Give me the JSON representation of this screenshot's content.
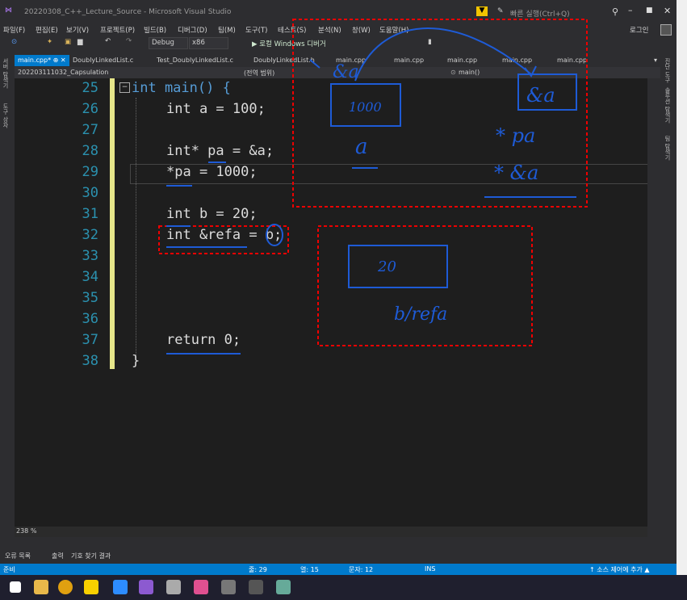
{
  "title": "20220308_C++_Lecture_Source - Microsoft Visual Studio",
  "search_placeholder": "빠른 실행(Ctrl+Q)",
  "login": "로그인",
  "menu": [
    "파일(F)",
    "편집(E)",
    "보기(V)",
    "프로젝트(P)",
    "빌드(B)",
    "디버그(D)",
    "팀(M)",
    "도구(T)",
    "테스트(S)",
    "분석(N)",
    "창(W)",
    "도움말(H)"
  ],
  "toolbar": {
    "config": "Debug",
    "platform": "x86",
    "run": "▶ 로컬 Windows 디버거"
  },
  "tabs": [
    "main.cpp*",
    "DoublyLinkedList.c",
    "Test_DoublyLinkedList.c",
    "DoublyLinkedList.h",
    "main.cpp",
    "main.cpp",
    "main.cpp",
    "main.cpp",
    "main.cpp"
  ],
  "nav": {
    "project": "202203111032_Capsulation",
    "scope": "(전역 범위)",
    "func": "main()"
  },
  "left_panel": [
    "서버 탐색기",
    "도구 상자"
  ],
  "right_panel": [
    "진단 도구",
    "솔루션 탐색기",
    "팀 탐색기"
  ],
  "lines": [
    {
      "n": "25",
      "text": "int main() {"
    },
    {
      "n": "26",
      "text": "int a = 100;"
    },
    {
      "n": "27",
      "text": ""
    },
    {
      "n": "28",
      "text": "int* pa = &a;"
    },
    {
      "n": "29",
      "text": "*pa = 1000;"
    },
    {
      "n": "30",
      "text": ""
    },
    {
      "n": "31",
      "text": "int b = 20;"
    },
    {
      "n": "32",
      "text": "int &refa = b;"
    },
    {
      "n": "33",
      "text": ""
    },
    {
      "n": "34",
      "text": ""
    },
    {
      "n": "35",
      "text": ""
    },
    {
      "n": "36",
      "text": ""
    },
    {
      "n": "37",
      "text": "return 0;"
    },
    {
      "n": "38",
      "text": "}"
    }
  ],
  "zoom": "238 %",
  "output_tabs": [
    "오류 목록",
    "출력",
    "기호 찾기 결과"
  ],
  "status": {
    "ready": "준비",
    "line": "줄: 29",
    "col": "열: 15",
    "char": "문자: 12",
    "ins": "INS",
    "scc": "↑ 소스 제어에 추가 ▲"
  },
  "annotations": {
    "amp_a_top": "&a",
    "box1000": "1000",
    "label_a": "a",
    "box_amp_a": "&a",
    "star_pa": "* pa",
    "star_amp_a": "* &a",
    "box20": "20",
    "b_refa": "b/refa"
  }
}
